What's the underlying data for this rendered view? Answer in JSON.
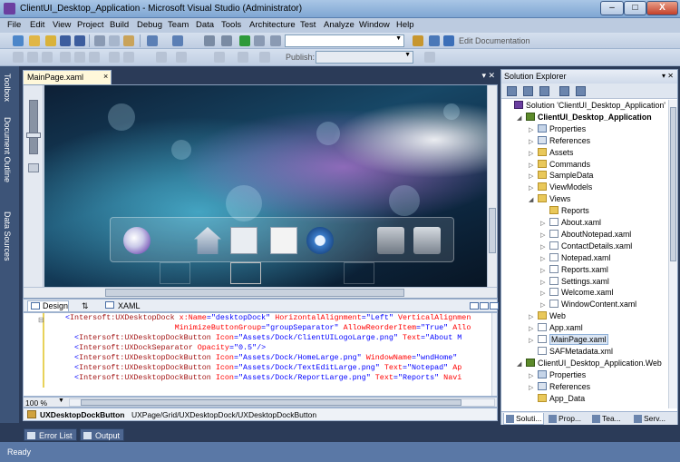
{
  "window": {
    "title": "ClientUI_Desktop_Application - Microsoft Visual Studio (Administrator)",
    "minimize": "‒",
    "maximize": "□",
    "close": "X"
  },
  "menu": [
    "File",
    "Edit",
    "View",
    "Project",
    "Build",
    "Debug",
    "Team",
    "Data",
    "Tools",
    "Architecture",
    "Test",
    "Analyze",
    "Window",
    "Help"
  ],
  "toolbar": {
    "edit_documentation": "Edit Documentation",
    "publish_label": "Publish:"
  },
  "side_tabs": [
    "Toolbox",
    "Document Outline",
    "Data Sources"
  ],
  "document": {
    "tab": "MainPage.xaml",
    "tab_close": "×",
    "zoom": "100 %"
  },
  "split_bar": {
    "design_tab": "Design",
    "swap": "⇅",
    "xaml_tab": "XAML"
  },
  "code_lines": [
    [
      {
        "t": "<",
        "c": "br"
      },
      {
        "t": "Intersoft:UXDesktopDock",
        "c": "el"
      },
      {
        "t": " x:Name",
        "c": "at"
      },
      {
        "t": "=\"desktopDock\"",
        "c": "val"
      },
      {
        "t": " HorizontalAlignment",
        "c": "at"
      },
      {
        "t": "=\"Left\"",
        "c": "val"
      },
      {
        "t": " VerticalAlignmen",
        "c": "at"
      }
    ],
    [
      {
        "t": "                        MinimizeButtonGroup",
        "c": "at"
      },
      {
        "t": "=\"groupSeparator\"",
        "c": "val"
      },
      {
        "t": " AllowReorderItem",
        "c": "at"
      },
      {
        "t": "=\"True\"",
        "c": "val"
      },
      {
        "t": " Allo",
        "c": "at"
      }
    ],
    [
      {
        "t": "  <",
        "c": "br"
      },
      {
        "t": "Intersoft:UXDesktopDockButton",
        "c": "el"
      },
      {
        "t": " Icon",
        "c": "at"
      },
      {
        "t": "=\"Assets/Dock/ClientUILogoLarge.png\"",
        "c": "val"
      },
      {
        "t": " Text",
        "c": "at"
      },
      {
        "t": "=\"About M",
        "c": "val"
      }
    ],
    [
      {
        "t": "  <",
        "c": "br"
      },
      {
        "t": "Intersoft:UXDockSeparator",
        "c": "el"
      },
      {
        "t": " Opacity",
        "c": "at"
      },
      {
        "t": "=\"0.5\"",
        "c": "val"
      },
      {
        "t": "/>",
        "c": "br"
      }
    ],
    [
      {
        "t": "  <",
        "c": "br"
      },
      {
        "t": "Intersoft:UXDesktopDockButton",
        "c": "el"
      },
      {
        "t": " Icon",
        "c": "at"
      },
      {
        "t": "=\"Assets/Dock/HomeLarge.png\"",
        "c": "val"
      },
      {
        "t": " WindowName",
        "c": "at"
      },
      {
        "t": "=\"wndHome\"",
        "c": "val"
      }
    ],
    [
      {
        "t": "  <",
        "c": "br"
      },
      {
        "t": "Intersoft:UXDesktopDockButton",
        "c": "el"
      },
      {
        "t": " Icon",
        "c": "at"
      },
      {
        "t": "=\"Assets/Dock/TextEditLarge.png\"",
        "c": "val"
      },
      {
        "t": " Text",
        "c": "at"
      },
      {
        "t": "=\"Notepad\"",
        "c": "val"
      },
      {
        "t": " Ap",
        "c": "at"
      }
    ],
    [
      {
        "t": "  <",
        "c": "br"
      },
      {
        "t": "Intersoft:UXDesktopDockButton",
        "c": "el"
      },
      {
        "t": " Icon",
        "c": "at"
      },
      {
        "t": "=\"Assets/Dock/ReportLarge.png\"",
        "c": "val"
      },
      {
        "t": " Text",
        "c": "at"
      },
      {
        "t": "=\"Reports\"",
        "c": "val"
      },
      {
        "t": " Navi",
        "c": "at"
      }
    ]
  ],
  "breadcrumb": {
    "current": "UXDesktopDockButton",
    "path": "UXPage/Grid/UXDesktopDock/UXDesktopDockButton"
  },
  "solution_explorer": {
    "title": "Solution Explorer",
    "pin": "▾ ✕",
    "tree": [
      {
        "label": "Solution 'ClientUI_Desktop_Application'",
        "icon": "sol",
        "level": 0,
        "exp": ""
      },
      {
        "label": "ClientUI_Desktop_Application",
        "icon": "proj",
        "level": 1,
        "exp": "◢",
        "bold": true
      },
      {
        "label": "Properties",
        "icon": "props",
        "level": 2,
        "exp": "▷"
      },
      {
        "label": "References",
        "icon": "refs",
        "level": 2,
        "exp": "▷"
      },
      {
        "label": "Assets",
        "icon": "folder",
        "level": 2,
        "exp": "▷"
      },
      {
        "label": "Commands",
        "icon": "folder",
        "level": 2,
        "exp": "▷"
      },
      {
        "label": "SampleData",
        "icon": "folder",
        "level": 2,
        "exp": "▷"
      },
      {
        "label": "ViewModels",
        "icon": "folder",
        "level": 2,
        "exp": "▷"
      },
      {
        "label": "Views",
        "icon": "folder",
        "level": 2,
        "exp": "◢"
      },
      {
        "label": "Reports",
        "icon": "folder",
        "level": 3,
        "exp": ""
      },
      {
        "label": "About.xaml",
        "icon": "file",
        "level": 3,
        "exp": "▷"
      },
      {
        "label": "AboutNotepad.xaml",
        "icon": "file",
        "level": 3,
        "exp": "▷"
      },
      {
        "label": "ContactDetails.xaml",
        "icon": "file",
        "level": 3,
        "exp": "▷"
      },
      {
        "label": "Notepad.xaml",
        "icon": "file",
        "level": 3,
        "exp": "▷"
      },
      {
        "label": "Reports.xaml",
        "icon": "file",
        "level": 3,
        "exp": "▷"
      },
      {
        "label": "Settings.xaml",
        "icon": "file",
        "level": 3,
        "exp": "▷"
      },
      {
        "label": "Welcome.xaml",
        "icon": "file",
        "level": 3,
        "exp": "▷"
      },
      {
        "label": "WindowContent.xaml",
        "icon": "file",
        "level": 3,
        "exp": "▷"
      },
      {
        "label": "Web",
        "icon": "folder",
        "level": 2,
        "exp": "▷"
      },
      {
        "label": "App.xaml",
        "icon": "file",
        "level": 2,
        "exp": "▷"
      },
      {
        "label": "MainPage.xaml",
        "icon": "file",
        "level": 2,
        "exp": "▷",
        "selected": true
      },
      {
        "label": "SAFMetadata.xml",
        "icon": "file",
        "level": 2,
        "exp": ""
      },
      {
        "label": "ClientUI_Desktop_Application.Web",
        "icon": "proj",
        "level": 1,
        "exp": "◢"
      },
      {
        "label": "Properties",
        "icon": "props",
        "level": 2,
        "exp": "▷"
      },
      {
        "label": "References",
        "icon": "refs",
        "level": 2,
        "exp": "▷"
      },
      {
        "label": "App_Data",
        "icon": "folder",
        "level": 2,
        "exp": ""
      }
    ],
    "tabs": [
      "Soluti...",
      "Prop...",
      "Tea...",
      "Serv..."
    ]
  },
  "bottom_tabs": [
    "Error List",
    "Output"
  ],
  "status": "Ready"
}
